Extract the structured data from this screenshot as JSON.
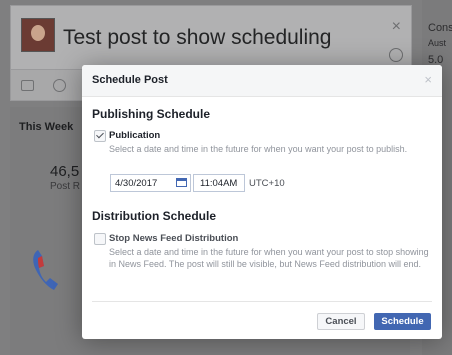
{
  "composer": {
    "title": "Test post to show scheduling",
    "close": "×"
  },
  "background": {
    "week_label": "This Week",
    "big_number": "46,5",
    "big_number_caption": "Post R",
    "right_col": [
      "Cons",
      "Aust",
      "5.0"
    ]
  },
  "modal": {
    "title": "Schedule Post",
    "close": "×",
    "publishing": {
      "heading": "Publishing Schedule",
      "option_label": "Publication",
      "checked": true,
      "help": "Select a date and time in the future for when you want your post to publish.",
      "date_value": "4/30/2017",
      "time_value": "11:04AM",
      "timezone": "UTC+10"
    },
    "distribution": {
      "heading": "Distribution Schedule",
      "option_label": "Stop News Feed Distribution",
      "checked": false,
      "help": "Select a date and time in the future for when you want your post to stop showing in News Feed. The post will still be visible, but News Feed distribution will end."
    },
    "buttons": {
      "cancel": "Cancel",
      "schedule": "Schedule"
    }
  }
}
